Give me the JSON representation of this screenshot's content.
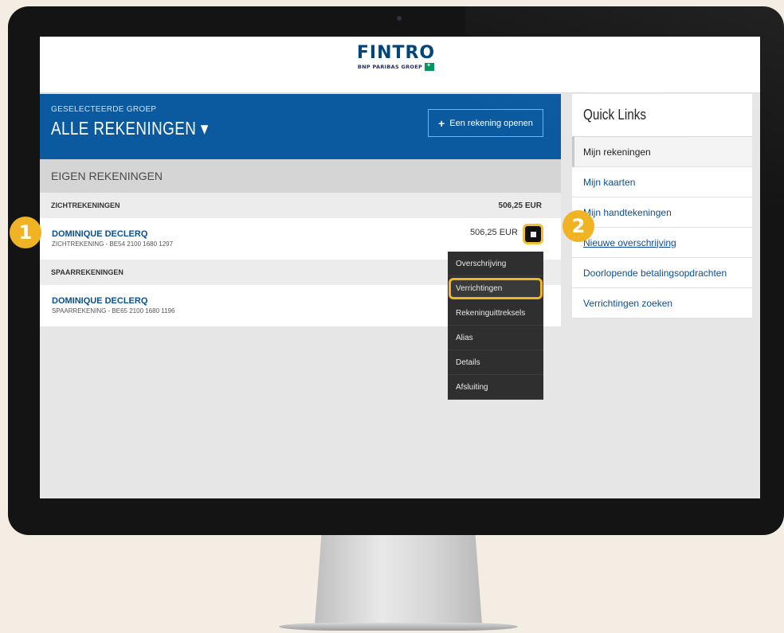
{
  "brand": {
    "name": "FINTRO",
    "sub": "BNP PARIBAS GROEP"
  },
  "group": {
    "kicker": "GESELECTEERDE GROEP",
    "title": "ALLE REKENINGEN",
    "open_button": "Een rekening openen"
  },
  "section_title": "EIGEN REKENINGEN",
  "zicht": {
    "label": "ZICHTREKENINGEN",
    "total": "506,25 EUR",
    "account": {
      "name": "DOMINIQUE DECLERQ",
      "number": "ZICHTREKENING - BE54 2100 1680 1297",
      "amount": "506,25 EUR"
    }
  },
  "spaar": {
    "label": "SPAARREKENINGEN",
    "account": {
      "name": "DOMINIQUE DECLERQ",
      "number": "SPAARREKENING - BE65 2100 1680 1196"
    }
  },
  "menu": [
    "Overschrijving",
    "Verrichtingen",
    "Rekeninguittreksels",
    "Alias",
    "Details",
    "Afsluiting"
  ],
  "quick_links": {
    "title": "Quick Links",
    "items": [
      "Mijn rekeningen",
      "Mijn kaarten",
      "Mijn handtekeningen",
      "Nieuwe overschrijving",
      "Doorlopende betalingsopdrachten",
      "Verrichtingen zoeken"
    ]
  },
  "callouts": [
    "1",
    "2"
  ],
  "colors": {
    "primary_blue": "#0b5aa0",
    "highlight": "#f0b323",
    "menu_bg": "#2f2f2f"
  }
}
